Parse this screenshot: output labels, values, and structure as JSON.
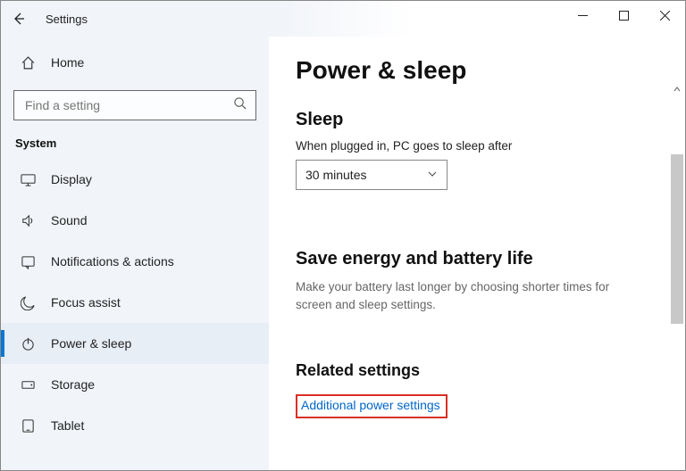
{
  "window": {
    "title": "Settings"
  },
  "sidebar": {
    "home_label": "Home",
    "search_placeholder": "Find a setting",
    "group_label": "System",
    "items": [
      {
        "icon": "display",
        "label": "Display"
      },
      {
        "icon": "sound",
        "label": "Sound"
      },
      {
        "icon": "notifications",
        "label": "Notifications & actions"
      },
      {
        "icon": "focus",
        "label": "Focus assist"
      },
      {
        "icon": "power",
        "label": "Power & sleep"
      },
      {
        "icon": "storage",
        "label": "Storage"
      },
      {
        "icon": "tablet",
        "label": "Tablet"
      }
    ],
    "selected_index": 4
  },
  "page": {
    "title": "Power & sleep",
    "sleep_section": "Sleep",
    "sleep_label": "When plugged in, PC goes to sleep after",
    "sleep_value": "30 minutes",
    "save_section": "Save energy and battery life",
    "save_desc": "Make your battery last longer by choosing shorter times for screen and sleep settings.",
    "related_section": "Related settings",
    "related_link": "Additional power settings"
  }
}
